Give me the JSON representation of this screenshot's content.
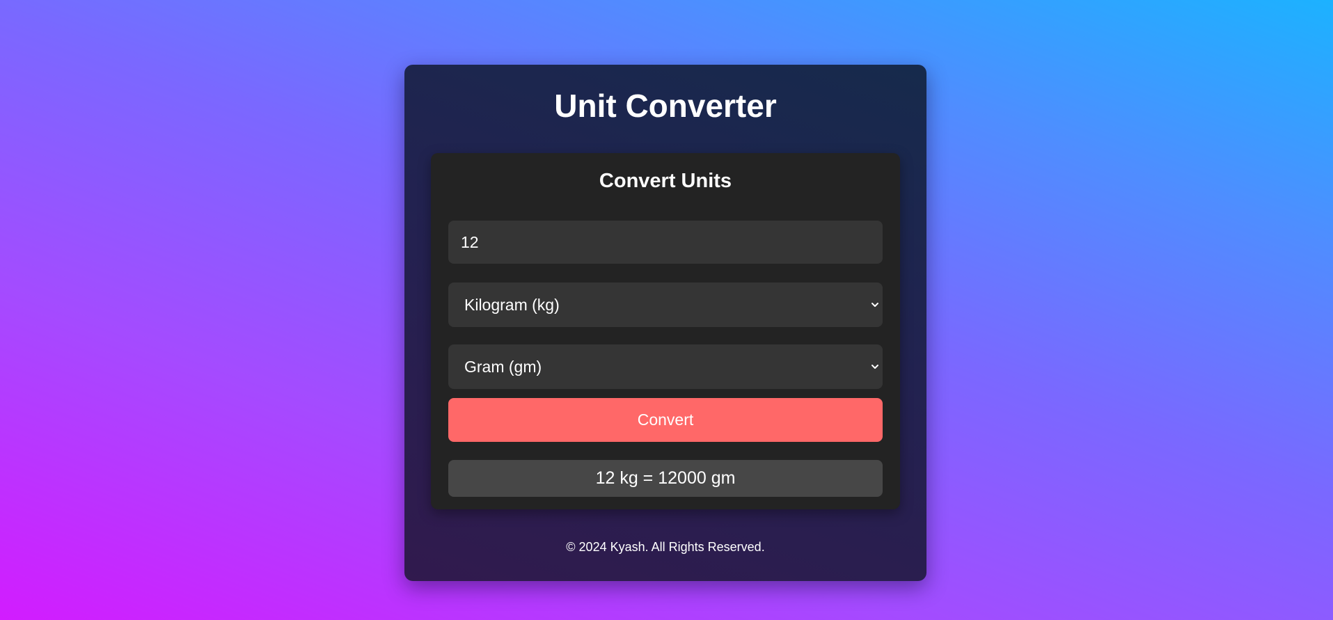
{
  "app": {
    "title": "Unit Converter"
  },
  "converter": {
    "heading": "Convert Units",
    "value_input": {
      "value": "12"
    },
    "from_unit": {
      "selected": "Kilogram (kg)"
    },
    "to_unit": {
      "selected": "Gram (gm)"
    },
    "convert_label": "Convert",
    "result": "12 kg = 12000 gm"
  },
  "footer": {
    "text": "© 2024 Kyash. All Rights Reserved."
  },
  "icons": {
    "dropdown": "chevron-down-icon"
  },
  "colors": {
    "card_top": "#162a4c",
    "card_bottom": "#311a4e",
    "panel": "#232323",
    "field": "#353535",
    "button": "#ff6868",
    "result": "#474747"
  }
}
